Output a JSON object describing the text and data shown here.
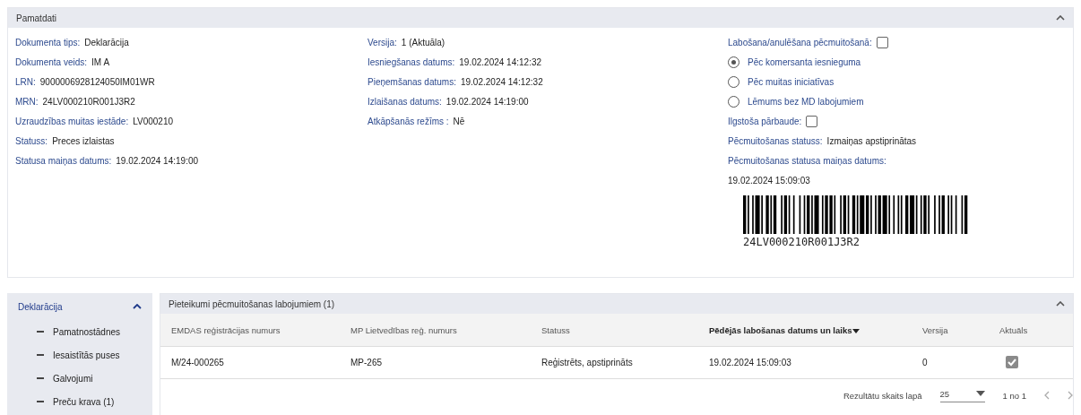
{
  "main_panel": {
    "title": "Pamatdati",
    "expanded": true,
    "col1": [
      {
        "label": "Dokumenta tips:",
        "value": "Deklarācija"
      },
      {
        "label": "Dokumenta veids:",
        "value": "IM A"
      },
      {
        "label": "LRN:",
        "value": "9000006928124050IM01WR"
      },
      {
        "label": "MRN:",
        "value": "24LV000210R001J3R2"
      },
      {
        "label": "Uzraudzības muitas iestāde:",
        "value": "LV000210"
      },
      {
        "label": "Statuss:",
        "value": "Preces izlaistas"
      },
      {
        "label": "Statusa maiņas datums:",
        "value": "19.02.2024 14:19:00"
      }
    ],
    "col2": [
      {
        "label": "Versija:",
        "value": "1 (Aktuāla)"
      },
      {
        "label": "Iesniegšanas datums:",
        "value": "19.02.2024 14:12:32"
      },
      {
        "label": "Pieņemšanas datums:",
        "value": "19.02.2024 14:12:32"
      },
      {
        "label": "Izlaišanas datums:",
        "value": "19.02.2024 14:19:00"
      },
      {
        "label": "Atkāpšanās režīms :",
        "value": "Nē"
      }
    ],
    "correction": {
      "label": "Labošana/anulēšana pēcmuitošanā:",
      "checked": false
    },
    "radios": [
      {
        "label": "Pēc komersanta iesnieguma",
        "selected": true
      },
      {
        "label": "Pēc muitas iniciatīvas",
        "selected": false
      },
      {
        "label": "Lēmums bez MD labojumiem",
        "selected": false
      }
    ],
    "long_check": {
      "label": "Ilgstoša pārbaude:",
      "checked": false
    },
    "post_status": {
      "label": "Pēcmuitošanas statuss:",
      "value": "Izmaiņas apstiprinātas"
    },
    "post_status_date": {
      "label": "Pēcmuitošanas statusa maiņas datums:",
      "value": "19.02.2024 15:09:03"
    },
    "barcode_text": "24LV000210R001J3R2"
  },
  "sidebar": {
    "title": "Deklarācija",
    "expanded": true,
    "items": [
      {
        "label": "Pamatnostādnes"
      },
      {
        "label": "Iesaistītās puses"
      },
      {
        "label": "Galvojumi"
      },
      {
        "label": "Preču krava (1)"
      }
    ]
  },
  "table_panel": {
    "title": "Pieteikumi pēcmuitošanas labojumiem (1)",
    "expanded": true,
    "columns": [
      {
        "label": "EMDAS reģistrācijas numurs",
        "sorted": false
      },
      {
        "label": "MP Lietvedības reģ. numurs",
        "sorted": false
      },
      {
        "label": "Statuss",
        "sorted": false
      },
      {
        "label": "Pēdējās labošanas datums un laiks",
        "sorted": true
      },
      {
        "label": "Versija",
        "sorted": false
      },
      {
        "label": "Aktuāls",
        "sorted": false
      }
    ],
    "rows": [
      {
        "cells": [
          "M/24-000265",
          "MP-265",
          "Reģistrēts, apstiprināts",
          "19.02.2024 15:09:03",
          "0"
        ],
        "current": true
      }
    ],
    "pagination": {
      "page_size_label": "Rezultātu skaits lapā",
      "page_size": "25",
      "range": "1 no 1"
    }
  }
}
